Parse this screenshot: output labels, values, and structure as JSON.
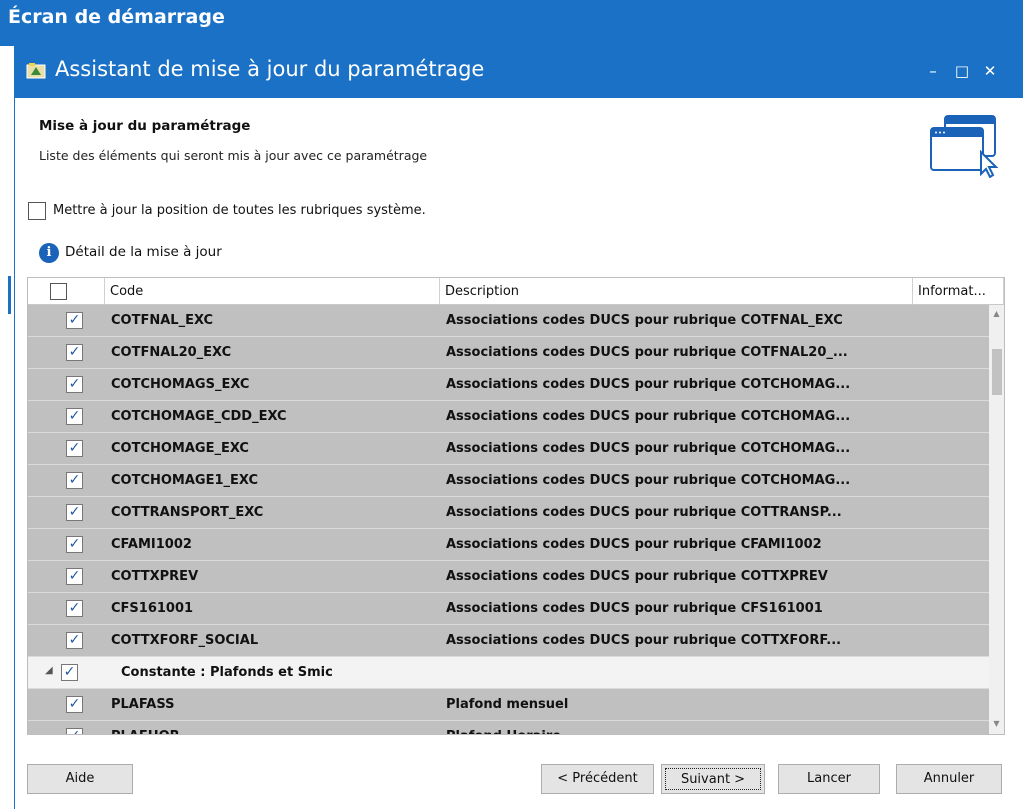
{
  "background_window": {
    "title": "Écran de démarrage"
  },
  "dialog": {
    "title": "Assistant de mise à jour du paramétrage",
    "controls": {
      "minimize": "–",
      "maximize": "□",
      "close": "✕"
    }
  },
  "header": {
    "title": "Mise à jour du paramétrage",
    "subtitle": "Liste des éléments qui seront mis à jour avec ce paramétrage"
  },
  "option": {
    "label": "Mettre à jour la position de toutes les rubriques système.",
    "checked": false
  },
  "detail": {
    "label": "Détail de la mise à jour"
  },
  "grid": {
    "columns": {
      "code": "Code",
      "description": "Description",
      "info": "Informat..."
    },
    "rows": [
      {
        "code": "COTFNAL_EXC",
        "description": "Associations codes DUCS pour rubrique COTFNAL_EXC",
        "checked": true
      },
      {
        "code": "COTFNAL20_EXC",
        "description": "Associations codes DUCS pour rubrique COTFNAL20_...",
        "checked": true
      },
      {
        "code": "COTCHOMAGS_EXC",
        "description": "Associations codes DUCS pour rubrique COTCHOMAG...",
        "checked": true
      },
      {
        "code": "COTCHOMAGE_CDD_EXC",
        "description": "Associations codes DUCS pour rubrique COTCHOMAG...",
        "checked": true
      },
      {
        "code": "COTCHOMAGE_EXC",
        "description": "Associations codes DUCS pour rubrique COTCHOMAG...",
        "checked": true
      },
      {
        "code": "COTCHOMAGE1_EXC",
        "description": "Associations codes DUCS pour rubrique COTCHOMAG...",
        "checked": true
      },
      {
        "code": "COTTRANSPORT_EXC",
        "description": "Associations codes DUCS pour rubrique COTTRANSP...",
        "checked": true
      },
      {
        "code": "CFAMI1002",
        "description": "Associations codes DUCS pour rubrique CFAMI1002",
        "checked": true
      },
      {
        "code": "COTTXPREV",
        "description": "Associations codes DUCS pour rubrique COTTXPREV",
        "checked": true
      },
      {
        "code": "CFS161001",
        "description": "Associations codes DUCS pour rubrique CFS161001",
        "checked": true
      },
      {
        "code": "COTTXFORF_SOCIAL",
        "description": "Associations codes DUCS pour rubrique COTTXFORF...",
        "checked": true
      },
      {
        "group": true,
        "code": "Constante : Plafonds et Smic",
        "description": "",
        "checked": true
      },
      {
        "code": "PLAFASS",
        "description": "Plafond mensuel",
        "checked": true
      },
      {
        "code": "PLAFHOR",
        "description": "Plafond Horaire",
        "checked": true
      }
    ]
  },
  "buttons": {
    "help": "Aide",
    "previous": "< Précédent",
    "next": "Suivant >",
    "run": "Lancer",
    "cancel": "Annuler"
  },
  "colors": {
    "accent": "#1a71c6",
    "row_selected": "#c0c0c0",
    "group_row": "#f3f3f3"
  },
  "icons": {
    "check": "✓",
    "expander": "◢",
    "info": "i"
  }
}
